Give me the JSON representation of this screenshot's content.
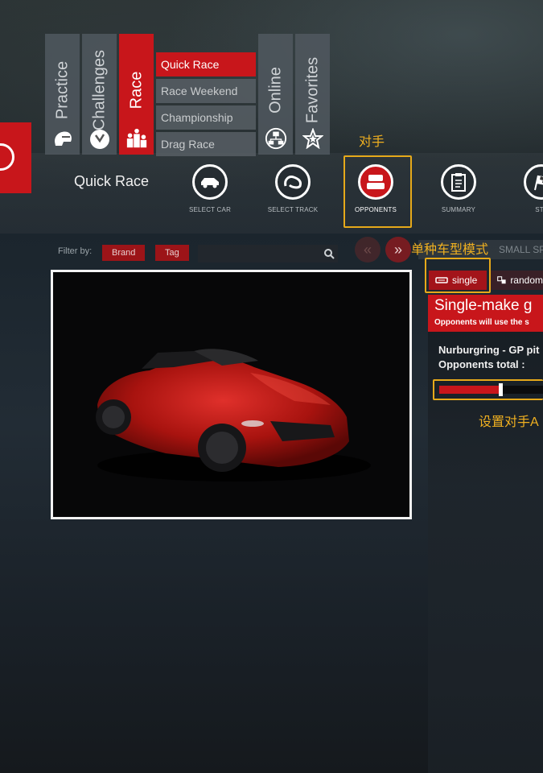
{
  "tabs": [
    {
      "label": "Practice",
      "icon": "helmet-icon",
      "active": false
    },
    {
      "label": "Challenges",
      "icon": "stopwatch-icon",
      "active": false
    },
    {
      "label": "Race",
      "icon": "podium-icon",
      "active": true
    },
    {
      "label": "Online",
      "icon": "network-icon",
      "active": false
    },
    {
      "label": "Favorites",
      "icon": "star-icon",
      "active": false
    }
  ],
  "submenu": [
    "Quick Race",
    "Race Weekend",
    "Championship",
    "Drag Race"
  ],
  "page_title": "Quick Race",
  "steps": [
    {
      "label": "SELECT CAR",
      "icon": "car-icon"
    },
    {
      "label": "SELECT TRACK",
      "icon": "track-icon"
    },
    {
      "label": "OPPONENTS",
      "icon": "opponents-icon"
    },
    {
      "label": "SUMMARY",
      "icon": "clipboard-icon"
    },
    {
      "label": "STA",
      "icon": "checkered-flag-icon"
    }
  ],
  "annotations": {
    "opponents": "对手",
    "single_mode": "单种车型模式",
    "set_ai": "设置对手A"
  },
  "filter": {
    "label": "Filter by:",
    "chips": [
      "Brand",
      "Tag"
    ],
    "search_value": ""
  },
  "car_nav": {
    "prev": "«",
    "next": "»"
  },
  "small_sp": "SMALL SPO",
  "modes": {
    "single": "single",
    "random": "random"
  },
  "panel": {
    "title": "Single-make g",
    "subtitle": "Opponents will use the s",
    "track_line": "Nurburgring - GP pit",
    "opponents_total": "Opponents total :",
    "slider_fraction": 0.53
  },
  "colors": {
    "accent": "#c8161b",
    "highlight": "#e6a91a"
  }
}
